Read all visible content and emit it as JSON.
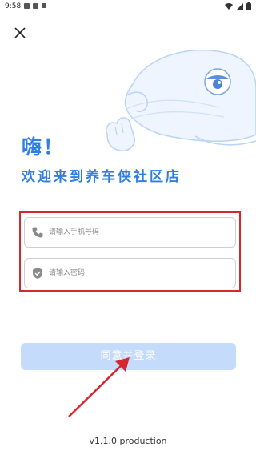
{
  "status_bar": {
    "time": "9:58"
  },
  "icons": {
    "close": "close-icon",
    "phone": "phone-icon",
    "shield": "shield-check-icon",
    "whale": "whale-illustration"
  },
  "header": {
    "greeting": "嗨！",
    "welcome": "欢迎来到养车侠社区店"
  },
  "form": {
    "phone_placeholder": "请输入手机号码",
    "password_placeholder": "请输入密码",
    "phone_value": "",
    "password_value": ""
  },
  "login": {
    "label": "同意并登录"
  },
  "footer": {
    "version": "v1.1.0 production"
  },
  "colors": {
    "accent": "#2f7fe0",
    "button_disabled": "#c4dbfb",
    "highlight": "#d6262e",
    "arrow": "#d6262e"
  }
}
